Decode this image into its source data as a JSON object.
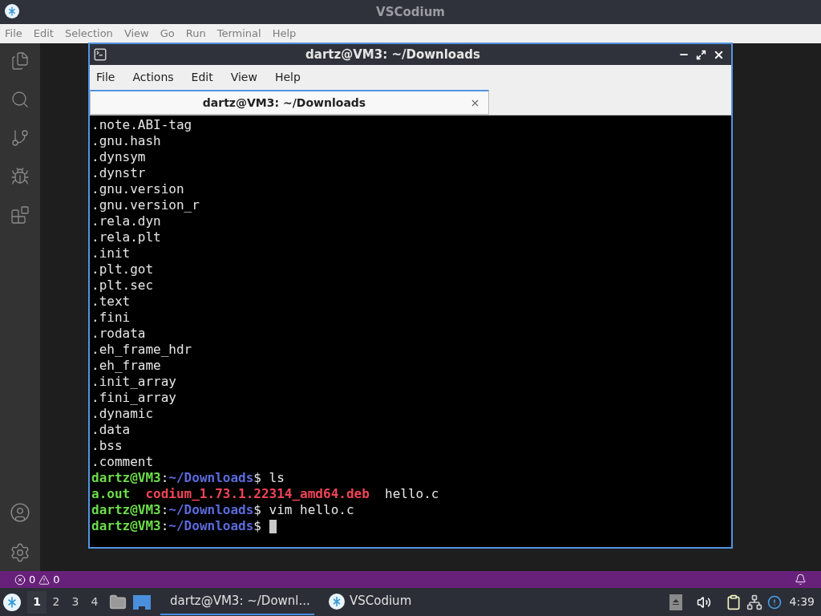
{
  "window": {
    "title": "VSCodium"
  },
  "menu": [
    "File",
    "Edit",
    "Selection",
    "View",
    "Go",
    "Run",
    "Terminal",
    "Help"
  ],
  "terminal": {
    "title": "dartz@VM3: ~/Downloads",
    "menu": [
      "File",
      "Actions",
      "Edit",
      "View",
      "Help"
    ],
    "tabs": [
      {
        "label": "dartz@VM3: ~/Downloads",
        "selected": true
      }
    ],
    "lines": [
      [
        {
          "text": ".note.ABI-tag",
          "kind": "plain"
        }
      ],
      [
        {
          "text": ".gnu.hash",
          "kind": "plain"
        }
      ],
      [
        {
          "text": ".dynsym",
          "kind": "plain"
        }
      ],
      [
        {
          "text": ".dynstr",
          "kind": "plain"
        }
      ],
      [
        {
          "text": ".gnu.version",
          "kind": "plain"
        }
      ],
      [
        {
          "text": ".gnu.version_r",
          "kind": "plain"
        }
      ],
      [
        {
          "text": ".rela.dyn",
          "kind": "plain"
        }
      ],
      [
        {
          "text": ".rela.plt",
          "kind": "plain"
        }
      ],
      [
        {
          "text": ".init",
          "kind": "plain"
        }
      ],
      [
        {
          "text": ".plt.got",
          "kind": "plain"
        }
      ],
      [
        {
          "text": ".plt.sec",
          "kind": "plain"
        }
      ],
      [
        {
          "text": ".text",
          "kind": "plain"
        }
      ],
      [
        {
          "text": ".fini",
          "kind": "plain"
        }
      ],
      [
        {
          "text": ".rodata",
          "kind": "plain"
        }
      ],
      [
        {
          "text": ".eh_frame_hdr",
          "kind": "plain"
        }
      ],
      [
        {
          "text": ".eh_frame",
          "kind": "plain"
        }
      ],
      [
        {
          "text": ".init_array",
          "kind": "plain"
        }
      ],
      [
        {
          "text": ".fini_array",
          "kind": "plain"
        }
      ],
      [
        {
          "text": ".dynamic",
          "kind": "plain"
        }
      ],
      [
        {
          "text": ".data",
          "kind": "plain"
        }
      ],
      [
        {
          "text": ".bss",
          "kind": "plain"
        }
      ],
      [
        {
          "text": ".comment",
          "kind": "plain"
        }
      ],
      [
        {
          "text": "dartz@VM3",
          "kind": "user"
        },
        {
          "text": ":",
          "kind": "plain"
        },
        {
          "text": "~/Downloads",
          "kind": "path"
        },
        {
          "text": "$ ls",
          "kind": "plain"
        }
      ],
      [
        {
          "text": "a.out",
          "kind": "exec"
        },
        {
          "text": "codium_1.73.1.22314_amd64.deb",
          "kind": "archive",
          "spaced": true
        },
        {
          "text": "  hello.c",
          "kind": "plain"
        }
      ],
      [
        {
          "text": "dartz@VM3",
          "kind": "user"
        },
        {
          "text": ":",
          "kind": "plain"
        },
        {
          "text": "~/Downloads",
          "kind": "path"
        },
        {
          "text": "$ vim hello.c",
          "kind": "plain"
        }
      ],
      [
        {
          "text": "dartz@VM3",
          "kind": "user"
        },
        {
          "text": ":",
          "kind": "plain"
        },
        {
          "text": "~/Downloads",
          "kind": "path"
        },
        {
          "text": "$ ",
          "kind": "plain"
        },
        {
          "kind": "cursor"
        }
      ]
    ]
  },
  "status_bar": {
    "errors": "0",
    "warnings": "0"
  },
  "taskbar": {
    "workspaces": [
      {
        "label": "1",
        "selected": true
      },
      {
        "label": "2",
        "selected": false
      },
      {
        "label": "3",
        "selected": false
      },
      {
        "label": "4",
        "selected": false
      }
    ],
    "tasks": [
      {
        "label": "dartz@VM3: ~/Downl...",
        "kind": "terminal",
        "selected": true
      },
      {
        "label": "VSCodium",
        "kind": "codium",
        "selected": false
      }
    ],
    "clock": "4:39"
  }
}
